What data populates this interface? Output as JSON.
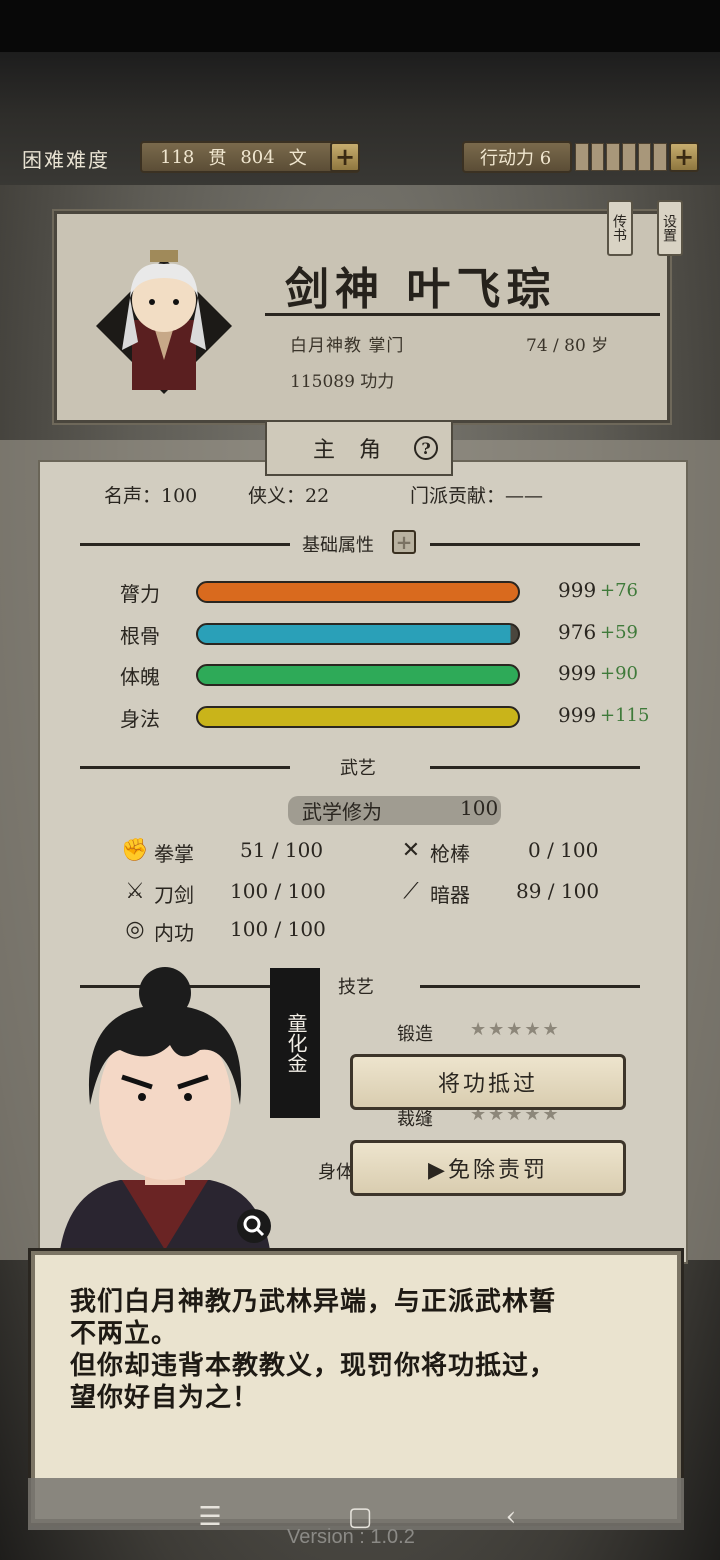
{
  "topbar": {
    "difficulty": "困难难度",
    "money_guan": "118",
    "money_guan_unit": "贯",
    "money_wen": "804",
    "money_wen_unit": "文",
    "plus": "+",
    "action_label": "行动力 6",
    "action_value": 6
  },
  "profile": {
    "title": "剑神",
    "name": "叶飞琮",
    "sect": "白月神教 掌门",
    "age": "74 / 80 岁",
    "power": "115089 功力",
    "tag_book": "传书",
    "tag_settings": "设置"
  },
  "tab": {
    "label": "主角",
    "help": "?"
  },
  "stats": {
    "fame": "名声：100",
    "chivalry": "侠义：22",
    "contribution": "门派贡献：——"
  },
  "basic": {
    "title": "基础属性",
    "plus": "+",
    "attributes": [
      {
        "label": "膂力",
        "value": "999",
        "bonus": "+76",
        "fill": 1.0,
        "color": "#d96a1e"
      },
      {
        "label": "根骨",
        "value": "976",
        "bonus": "+59",
        "fill": 0.977,
        "color": "#2aa0b8"
      },
      {
        "label": "体魄",
        "value": "999",
        "bonus": "+90",
        "fill": 1.0,
        "color": "#2eaa58"
      },
      {
        "label": "身法",
        "value": "999",
        "bonus": "+115",
        "fill": 1.0,
        "color": "#c9b41a"
      }
    ]
  },
  "martial": {
    "title": "武艺",
    "mastery_label": "武学修为",
    "mastery_value": "100",
    "skills": [
      {
        "label": "拳掌",
        "value": "51 / 100",
        "icon": "fist-icon"
      },
      {
        "label": "枪棒",
        "value": "0 / 100",
        "icon": "spear-icon"
      },
      {
        "label": "刀剑",
        "value": "100 / 100",
        "icon": "swords-icon"
      },
      {
        "label": "暗器",
        "value": "89 / 100",
        "icon": "dart-icon"
      },
      {
        "label": "内功",
        "value": "100 / 100",
        "icon": "neigong-icon"
      }
    ]
  },
  "crafts": {
    "title": "技艺",
    "forge": "锻造",
    "sew": "裁缝"
  },
  "body": {
    "title": "身体"
  },
  "npc": {
    "name": "童化金"
  },
  "choices": {
    "first": "将功抵过",
    "second": "▶免除责罚"
  },
  "dialog": {
    "line1": "我们白月神教乃武林异端，与正派武林誓",
    "line2": "不两立。",
    "line3": "但你却违背本教教义，现罚你将功抵过，",
    "line4": "望你好自为之！"
  },
  "footer": {
    "version": "Version : 1.0.2"
  }
}
